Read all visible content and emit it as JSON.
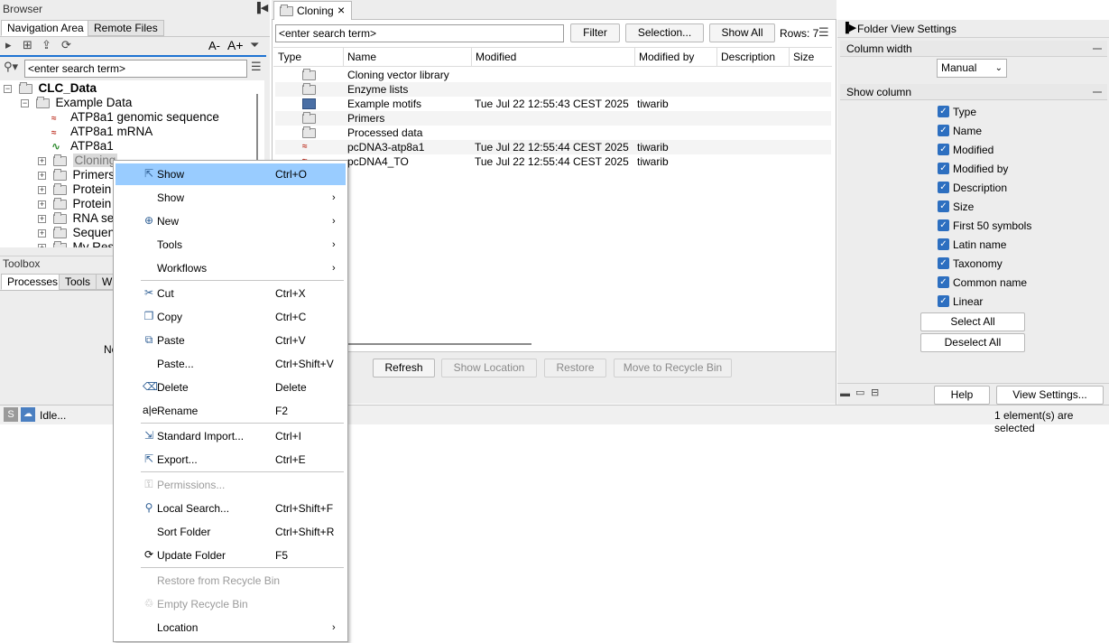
{
  "browser": {
    "title": "Browser",
    "tabs": [
      "Navigation Area",
      "Remote Files"
    ],
    "search_placeholder": "<enter search term>",
    "font_minus": "A-",
    "font_plus": "A+",
    "tree": {
      "root": "CLC_Data",
      "example_data": "Example Data",
      "items": [
        "ATP8a1 genomic sequence",
        "ATP8a1 mRNA",
        "ATP8a1",
        "Cloning",
        "Primers",
        "Protein",
        "Protein",
        "RNA se",
        "Sequen",
        "My Res"
      ]
    }
  },
  "toolbox": {
    "title": "Toolbox",
    "tabs": [
      "Processes",
      "Tools",
      "W"
    ],
    "content": "No"
  },
  "status": {
    "left": "Idle...",
    "right": "1 element(s) are selected",
    "s_label": "S"
  },
  "editor": {
    "tab_label": "Cloning",
    "search_placeholder": "<enter search term>",
    "filter": "Filter",
    "selection": "Selection...",
    "show_all": "Show All",
    "rows": "Rows: 7",
    "columns": [
      "Type",
      "Name",
      "Modified",
      "Modified by",
      "Description",
      "Size"
    ],
    "rows_data": [
      {
        "name": "Cloning vector library",
        "modified": "",
        "by": ""
      },
      {
        "name": "Enzyme lists",
        "modified": "",
        "by": ""
      },
      {
        "name": "Example motifs",
        "modified": "Tue Jul 22 12:55:43 CEST 2025",
        "by": "tiwarib"
      },
      {
        "name": "Primers",
        "modified": "",
        "by": ""
      },
      {
        "name": "Processed data",
        "modified": "",
        "by": ""
      },
      {
        "name": "pcDNA3-atp8a1",
        "modified": "Tue Jul 22 12:55:44 CEST 2025",
        "by": "tiwarib"
      },
      {
        "name": "pcDNA4_TO",
        "modified": "Tue Jul 22 12:55:44 CEST 2025",
        "by": "tiwarib"
      }
    ],
    "buttons": [
      "Refresh",
      "Show Location",
      "Restore",
      "Move to Recycle Bin"
    ]
  },
  "settings": {
    "title": "Folder View Settings",
    "column_width_label": "Column width",
    "column_width_value": "Manual",
    "show_column_label": "Show column",
    "columns": [
      "Type",
      "Name",
      "Modified",
      "Modified by",
      "Description",
      "Size",
      "First 50 symbols",
      "Latin name",
      "Taxonomy",
      "Common name",
      "Linear"
    ],
    "select_all": "Select All",
    "deselect_all": "Deselect All",
    "help": "Help",
    "view_settings": "View Settings..."
  },
  "context_menu": {
    "items": [
      {
        "label": "Show",
        "shortcut": "Ctrl+O",
        "icon": "open-icon"
      },
      {
        "label": "Show",
        "shortcut": "",
        "icon": ""
      },
      {
        "label": "New",
        "shortcut": "",
        "icon": "new-icon"
      },
      {
        "label": "Tools",
        "shortcut": "",
        "icon": ""
      },
      {
        "label": "Workflows",
        "shortcut": "",
        "icon": ""
      },
      {
        "label": "Cut",
        "shortcut": "Ctrl+X",
        "icon": "scissors-icon"
      },
      {
        "label": "Copy",
        "shortcut": "Ctrl+C",
        "icon": "copy-icon"
      },
      {
        "label": "Paste",
        "shortcut": "Ctrl+V",
        "icon": "paste-icon"
      },
      {
        "label": "Paste...",
        "shortcut": "Ctrl+Shift+V",
        "icon": ""
      },
      {
        "label": "Delete",
        "shortcut": "Delete",
        "icon": "delete-icon"
      },
      {
        "label": "Rename",
        "shortcut": "F2",
        "icon": "rename-icon"
      },
      {
        "label": "Standard Import...",
        "shortcut": "Ctrl+I",
        "icon": "import-icon"
      },
      {
        "label": "Export...",
        "shortcut": "Ctrl+E",
        "icon": "export-icon"
      },
      {
        "label": "Permissions...",
        "shortcut": "",
        "icon": "permissions-icon"
      },
      {
        "label": "Local Search...",
        "shortcut": "Ctrl+Shift+F",
        "icon": "search-icon"
      },
      {
        "label": "Sort Folder",
        "shortcut": "Ctrl+Shift+R",
        "icon": ""
      },
      {
        "label": "Update Folder",
        "shortcut": "F5",
        "icon": "refresh-icon"
      },
      {
        "label": "Restore from Recycle Bin",
        "shortcut": "",
        "icon": ""
      },
      {
        "label": "Empty Recycle Bin",
        "shortcut": "",
        "icon": "recycle-icon"
      },
      {
        "label": "Location",
        "shortcut": "",
        "icon": ""
      }
    ]
  },
  "colors": {
    "highlight": "#99ccff",
    "accent": "#2d6fc0",
    "tab_underline": "#1e73d2"
  }
}
